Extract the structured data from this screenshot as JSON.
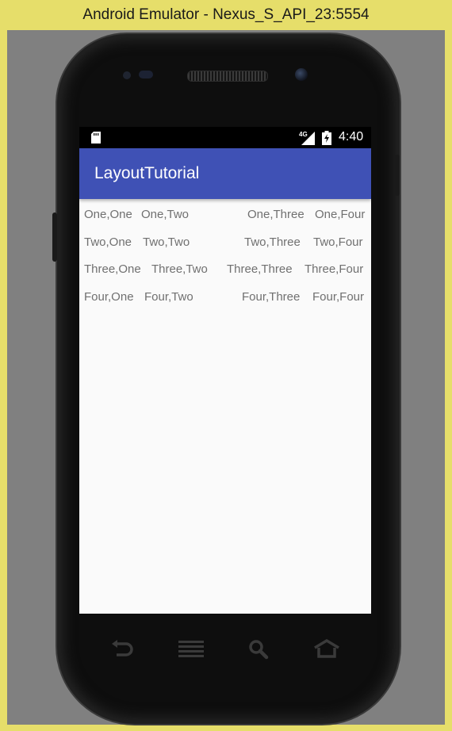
{
  "window": {
    "title": "Android Emulator - Nexus_S_API_23:5554"
  },
  "status_bar": {
    "network_label": "4G",
    "time": "4:40"
  },
  "app_bar": {
    "title": "LayoutTutorial"
  },
  "grid": {
    "rows": [
      [
        "One,One",
        "One,Two",
        "One,Three",
        "One,Four"
      ],
      [
        "Two,One",
        "Two,Two",
        "Two,Three",
        "Two,Four"
      ],
      [
        "Three,One",
        "Three,Two",
        "Three,Three",
        "Three,Four"
      ],
      [
        "Four,One",
        "Four,Two",
        "Four,Three",
        "Four,Four"
      ]
    ]
  },
  "icons": {
    "sd_card": "sd-card-icon",
    "signal": "signal-icon",
    "battery": "battery-charging-icon",
    "back": "back-icon",
    "menu": "menu-icon",
    "search": "search-icon",
    "home": "home-icon"
  },
  "colors": {
    "app_bar": "#3f51b5",
    "cell_text": "#707070",
    "emulator_frame": "#e6de6a"
  }
}
